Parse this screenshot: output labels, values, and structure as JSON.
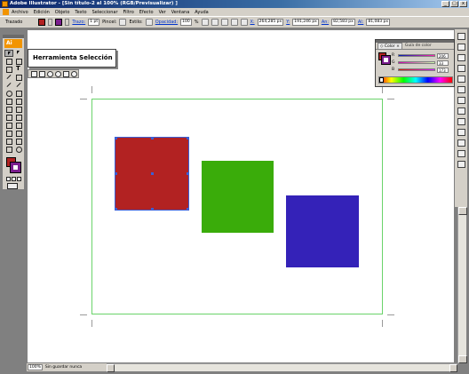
{
  "window": {
    "title": "Adobe Illustrator - [Sin título-2 al 100% (RGB/Previsualizar) ]",
    "minimize": "_",
    "maximize": "□",
    "close": "x"
  },
  "menu": {
    "items": [
      "Archivo",
      "Edición",
      "Objeto",
      "Texto",
      "Seleccionar",
      "Filtro",
      "Efecto",
      "Ver",
      "Ventana",
      "Ayuda"
    ]
  },
  "control_bar": {
    "path_label": "Trazado",
    "stroke_label": "Trazo:",
    "stroke_value": "1 pt",
    "brush_label": "Pincel:",
    "style_label": "Estilo:",
    "opacity_label": "Opacidad:",
    "opacity_value": "100",
    "opacity_unit": "%",
    "x_label": "X:",
    "x_value": "264,285 px",
    "y_label": "Y:",
    "y_value": "191,246 px",
    "w_label": "An:",
    "w_value": "82,583 px",
    "h_label": "Al:",
    "h_value": "81,083 px"
  },
  "toolbox": {
    "logo": "Ai",
    "fill_color": "#b22222",
    "stroke_color": "#7a1d8e"
  },
  "tooltip": {
    "text": "Herramienta Selección"
  },
  "color_panel": {
    "tab_color": "◇ Color ×",
    "tab_guide": "Guía de color",
    "rows": [
      {
        "letter": "R",
        "value": "206"
      },
      {
        "letter": "G",
        "value": "33"
      },
      {
        "letter": "B",
        "value": "173"
      }
    ]
  },
  "canvas": {
    "shapes": [
      {
        "name": "red-square",
        "color": "#b22222",
        "selected": true
      },
      {
        "name": "green-square",
        "color": "#3aac0a",
        "selected": false
      },
      {
        "name": "blue-square",
        "color": "#3422b8",
        "selected": false
      }
    ]
  },
  "status_bar": {
    "zoom": "100%",
    "status": "Sin guardar nunca"
  }
}
